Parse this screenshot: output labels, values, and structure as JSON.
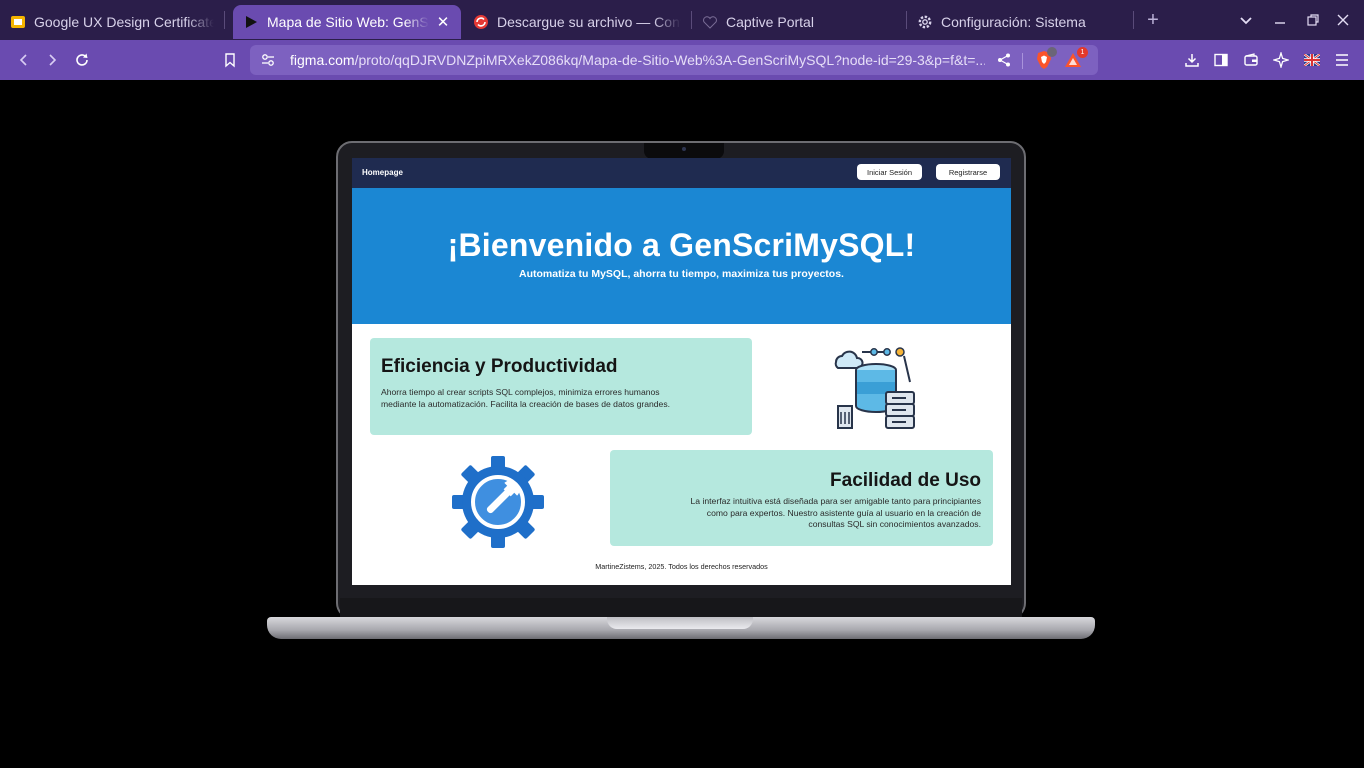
{
  "browser": {
    "tabs": [
      {
        "title": "Google UX Design Certificate",
        "icon": "slides-icon",
        "active": false
      },
      {
        "title": "Mapa de Sitio Web: GenScriMySQL",
        "icon": "play-icon",
        "active": true
      },
      {
        "title": "Descargue su archivo — Convertio",
        "icon": "convertio-icon",
        "active": false
      },
      {
        "title": "Captive Portal",
        "icon": "heart-icon",
        "active": false
      },
      {
        "title": "Configuración: Sistema",
        "icon": "gear-icon",
        "active": false
      }
    ],
    "url_host": "figma.com",
    "url_path": "/proto/qqDJRVDNZpiMRXekZ086kq/Mapa-de-Sitio-Web%3A-GenScriMySQL?node-id=29-3&p=f&t=...",
    "brave_badge": "",
    "rewards_badge": "1",
    "colors": {
      "tabstrip": "#2b1e4a",
      "toolbar": "#6a4bb0",
      "active_tab": "#6a4bb0"
    }
  },
  "prototype": {
    "nav": {
      "home": "Homepage",
      "login": "Iniciar Sesión",
      "register": "Registrarse"
    },
    "hero": {
      "title": "¡Bienvenido a GenScriMySQL!",
      "subtitle": "Automatiza tu MySQL, ahorra tu tiempo, maximiza tus proyectos."
    },
    "card1": {
      "title": "Eficiencia y Productividad",
      "line1": "Ahorra tiempo al crear scripts SQL complejos, minimiza errores humanos",
      "line2": "mediante la automatización. Facilita la creación de bases de datos grandes."
    },
    "card2": {
      "title": "Facilidad de Uso",
      "line1": "La interfaz intuitiva está diseñada para ser amigable tanto para principiantes",
      "line2": "como para expertos. Nuestro asistente guía al usuario en la creación de",
      "line3": "consultas SQL sin conocimientos avanzados."
    },
    "footer": "MartineZistems, 2025. Todos los derechos reservados",
    "colors": {
      "hero": "#1b87d3",
      "nav": "#1f2b50",
      "card": "#b5e8de"
    }
  }
}
